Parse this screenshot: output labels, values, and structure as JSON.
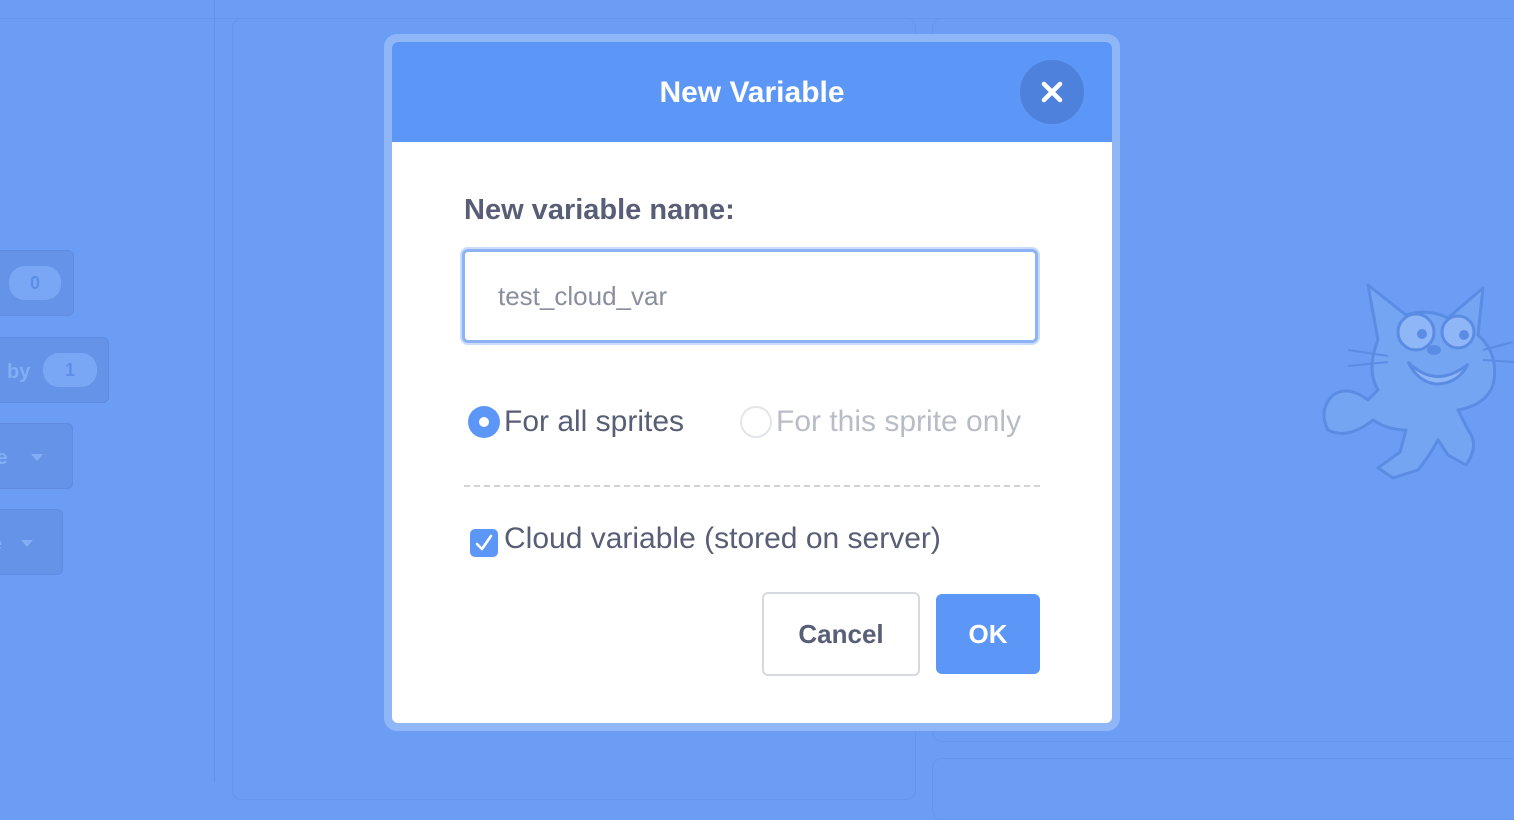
{
  "background": {
    "blocks": [
      {
        "label": "",
        "value": "0"
      },
      {
        "label": "by",
        "value": "1"
      },
      {
        "label": "le",
        "value": ""
      },
      {
        "label": "e",
        "value": ""
      }
    ]
  },
  "dialog": {
    "title": "New Variable",
    "close_icon": "close-icon",
    "name_label": "New variable name:",
    "name_value": "test_cloud_var",
    "scope_options": [
      {
        "label": "For all sprites",
        "selected": true
      },
      {
        "label": "For this sprite only",
        "selected": false,
        "disabled": true
      }
    ],
    "cloud_checkbox": {
      "label": "Cloud variable (stored on server)",
      "checked": true
    },
    "cancel_label": "Cancel",
    "ok_label": "OK"
  },
  "colors": {
    "accent": "#5c96f7",
    "overlay": "#6b9df5",
    "text": "#575e75",
    "disabled_text": "#b8bcc6"
  }
}
